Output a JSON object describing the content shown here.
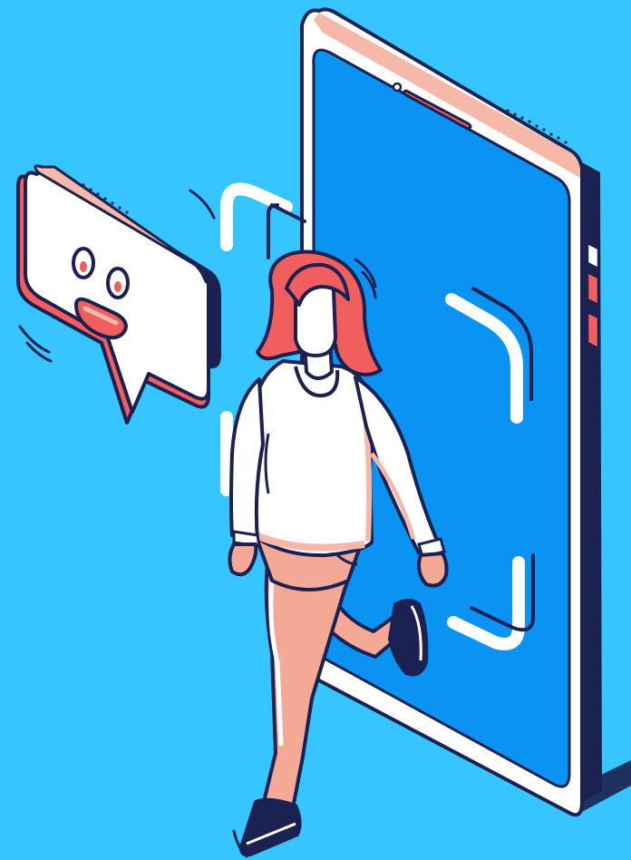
{
  "scene": {
    "background": "#36C5FF",
    "palette": {
      "outline": "#1B2150",
      "phone_screen": "#0A93F2",
      "phone_frame_highlight": "#F6B8A8",
      "accent_red": "#F05E5E",
      "skin": "#F4A896",
      "white": "#FFFFFF"
    },
    "elements": [
      "smartphone",
      "face-scan-frame",
      "speech-bubble",
      "smiling-face-icon",
      "woman-walking"
    ]
  }
}
